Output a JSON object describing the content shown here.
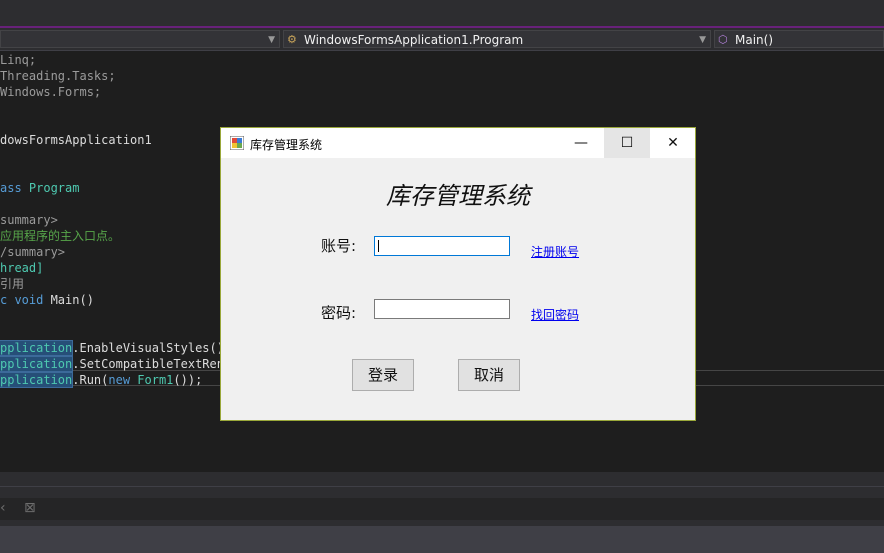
{
  "editor": {
    "nav": {
      "class_combo": "WindowsFormsApplication1.Program",
      "member_combo": "Main()"
    },
    "code_lines": [
      [
        {
          "t": "Linq;",
          "c": "gray"
        }
      ],
      [
        {
          "t": "Threading.Tasks;",
          "c": "gray"
        }
      ],
      [
        {
          "t": "Windows.Forms;",
          "c": "gray"
        }
      ],
      [
        {
          "t": "",
          "c": ""
        }
      ],
      [
        {
          "t": "",
          "c": ""
        }
      ],
      [
        {
          "t": "dowsFormsApplication1",
          "c": ""
        }
      ],
      [
        {
          "t": "",
          "c": ""
        }
      ],
      [
        {
          "t": "",
          "c": ""
        }
      ],
      [
        {
          "t": "ass ",
          "c": "kw"
        },
        {
          "t": "Program",
          "c": "type"
        }
      ],
      [
        {
          "t": "",
          "c": ""
        }
      ],
      [
        {
          "t": "summary>",
          "c": "gray"
        }
      ],
      [
        {
          "t": "应用程序的主入口点。",
          "c": "comment"
        }
      ],
      [
        {
          "t": "/summary>",
          "c": "gray"
        }
      ],
      [
        {
          "t": "hread]",
          "c": "type"
        }
      ],
      [
        {
          "t": "引用",
          "c": "gray"
        }
      ],
      [
        {
          "t": "c ",
          "c": "kw"
        },
        {
          "t": "void ",
          "c": "kw"
        },
        {
          "t": "Main()",
          "c": ""
        }
      ],
      [
        {
          "t": "",
          "c": ""
        }
      ],
      [
        {
          "t": "",
          "c": ""
        }
      ],
      [
        {
          "t": "pplication",
          "c": "hl"
        },
        {
          "t": ".EnableVisualStyles();",
          "c": ""
        }
      ],
      [
        {
          "t": "pplication",
          "c": "hl"
        },
        {
          "t": ".SetCompatibleTextRend",
          "c": ""
        }
      ],
      [
        {
          "t": "pplication",
          "c": "hl"
        },
        {
          "t": ".Run(",
          "c": ""
        },
        {
          "t": "new ",
          "c": "kw"
        },
        {
          "t": "Form1",
          "c": "type"
        },
        {
          "t": "());",
          "c": ""
        }
      ]
    ],
    "bottom_icons": [
      "chevron-left-icon",
      "clear-all-icon"
    ]
  },
  "form": {
    "title": "库存管理系统",
    "heading": "库存管理系统",
    "account_label": "账号:",
    "account_value": "",
    "register_link": "注册账号",
    "password_label": "密码:",
    "password_value": "",
    "forgot_link": "找回密码",
    "login_button": "登录",
    "cancel_button": "取消",
    "minimize_glyph": "—",
    "maximize_glyph": "☐",
    "close_glyph": "✕"
  },
  "colors": {
    "editor_bg": "#1e1e1e",
    "keyword": "#569cd6",
    "type": "#4ec9b0",
    "comment": "#57a64a",
    "accent_purple": "#68217a",
    "link": "#0000ee"
  }
}
